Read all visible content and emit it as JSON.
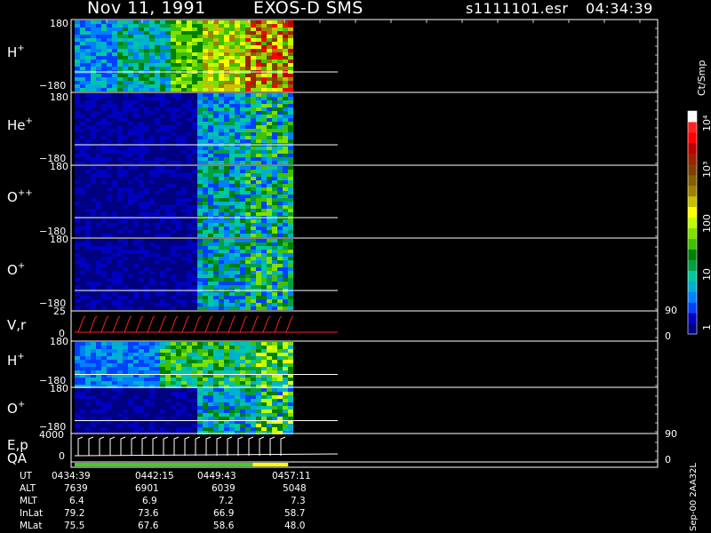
{
  "header": {
    "date": "Nov 11, 1991",
    "instrument": "EXOS-D SMS",
    "file": "s1111101.esr",
    "time": "04:34:39"
  },
  "panels": [
    {
      "id": "h",
      "species": "H",
      "charge": "+",
      "ymax": "180",
      "ymin": "−180"
    },
    {
      "id": "he",
      "species": "He",
      "charge": "+",
      "ymax": "180",
      "ymin": "−180"
    },
    {
      "id": "opp",
      "species": "O",
      "charge": "++",
      "ymax": "180",
      "ymin": "−180"
    },
    {
      "id": "op",
      "species": "O",
      "charge": "+",
      "ymax": "180",
      "ymin": "−180"
    },
    {
      "id": "vr",
      "label": "V,r",
      "ymax": "25",
      "ymin": "0",
      "right_max": "90",
      "right_min": "0"
    },
    {
      "id": "h2",
      "species": "H",
      "charge": "+",
      "ymax": "180",
      "ymin": "−180"
    },
    {
      "id": "o2",
      "species": "O",
      "charge": "+",
      "ymax": "180",
      "ymin": "−180"
    },
    {
      "id": "ep",
      "label": "E,p",
      "ymax": "4000",
      "ymin": "0",
      "right_max": "90",
      "right_min": "0"
    },
    {
      "id": "qa",
      "label": "QA"
    }
  ],
  "colorbar": {
    "unit": "Ct/Smp",
    "ticks": [
      "1",
      "10",
      "100",
      "10³",
      "10⁴"
    ],
    "colors": [
      "#000080",
      "#0000c0",
      "#0040ff",
      "#0080ff",
      "#00b0d0",
      "#00c8a0",
      "#00a040",
      "#008000",
      "#40c000",
      "#80e000",
      "#c0ff00",
      "#ffff00",
      "#c8c000",
      "#a08000",
      "#806000",
      "#804000",
      "#a02000",
      "#c00000",
      "#ff0000",
      "#ff2020",
      "#ffffff"
    ]
  },
  "footer": {
    "rows": [
      {
        "label": "UT",
        "values": [
          "0434:39",
          "0442:15",
          "0449:43",
          "0457:11"
        ]
      },
      {
        "label": "ALT",
        "values": [
          "7639",
          "6901",
          "6039",
          "5048"
        ]
      },
      {
        "label": "MLT",
        "values": [
          "6.4",
          "6.9",
          "7.2",
          "7.3"
        ]
      },
      {
        "label": "InLat",
        "values": [
          "79.2",
          "73.6",
          "66.9",
          "58.7"
        ]
      },
      {
        "label": "MLat",
        "values": [
          "75.5",
          "67.6",
          "58.6",
          "48.0"
        ]
      }
    ],
    "side_label": "Sep-00 2AA32L"
  },
  "chart_data": {
    "type": "heatmap",
    "title": "Nov 11, 1991 EXOS-D SMS",
    "x_ticks": [
      "0434:39",
      "0442:15",
      "0449:43",
      "0457:11"
    ],
    "data_end_fraction": 0.37,
    "spectrogram_panels": [
      "H+",
      "He+",
      "O++",
      "O+",
      "H+",
      "O+"
    ],
    "ylim": [
      -180,
      180
    ],
    "colorbar_ticks": [
      "1",
      "10",
      "100",
      "10³",
      "10⁴"
    ],
    "line_panels": [
      {
        "name": "V,r",
        "ylim": [
          0,
          25
        ],
        "right_ylim": [
          0,
          90
        ]
      },
      {
        "name": "E,p",
        "ylim": [
          0,
          4000
        ],
        "right_ylim": [
          0,
          90
        ]
      }
    ]
  }
}
